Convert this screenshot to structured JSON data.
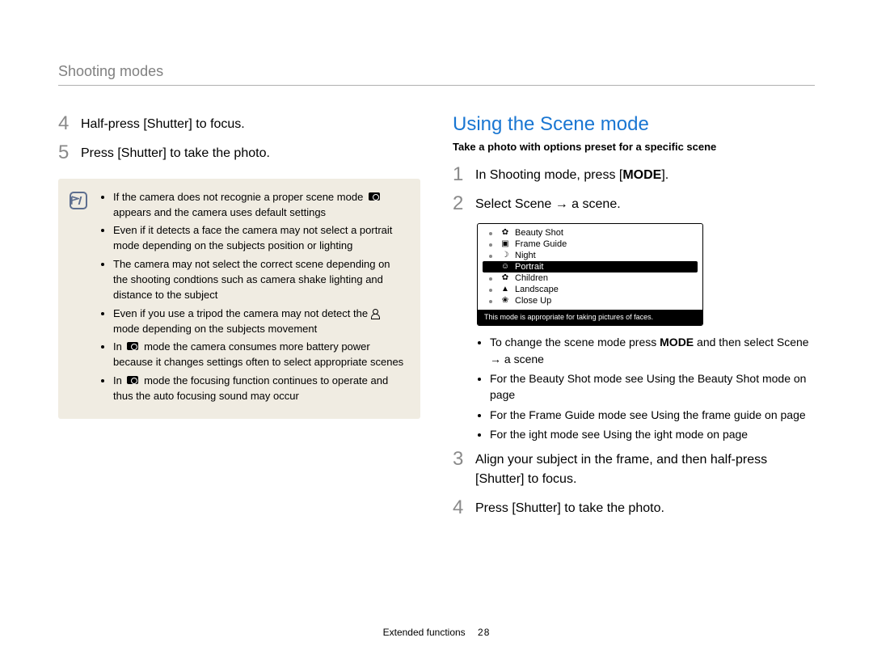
{
  "header": {
    "title": "Shooting modes"
  },
  "left": {
    "steps": [
      {
        "num": "4",
        "text": "Half-press [Shutter] to focus."
      },
      {
        "num": "5",
        "text": "Press [Shutter] to take the photo."
      }
    ],
    "note": [
      {
        "pre": "If the camera does not recognie a proper scene mode ",
        "icon": "cam",
        "post": " appears and the camera uses default settings"
      },
      {
        "pre": "Even if it detects a face the camera may not select a portrait mode depending on the subjects position or lighting",
        "icon": "",
        "post": ""
      },
      {
        "pre": "The camera may not select the correct scene depending on the shooting condtions such as camera shake lighting and distance to the subject",
        "icon": "",
        "post": ""
      },
      {
        "pre": "Even if you use a tripod the camera may not detect the ",
        "icon": "person",
        "post": " mode depending on the subjects movement"
      },
      {
        "pre": "In ",
        "icon": "cam",
        "post": " mode the camera consumes more battery power because it changes settings often to select appropriate scenes"
      },
      {
        "pre": "In ",
        "icon": "cam",
        "post": " mode the focusing function continues to operate and thus the auto focusing sound may occur"
      }
    ]
  },
  "right": {
    "section_title": "Using the Scene mode",
    "section_sub": "Take a photo with options preset for a specific scene",
    "step1_pre": "In Shooting mode, press [",
    "step1_bold": "MODE",
    "step1_post": "].",
    "step2": "Select Scene → a scene.",
    "scene_items": [
      {
        "icon": "✿",
        "label": "Beauty Shot"
      },
      {
        "icon": "▣",
        "label": "Frame Guide"
      },
      {
        "icon": "☽",
        "label": "Night"
      },
      {
        "icon": "☺",
        "label": "Portrait",
        "selected": true
      },
      {
        "icon": "✿",
        "label": "Children"
      },
      {
        "icon": "▲",
        "label": "Landscape"
      },
      {
        "icon": "❀",
        "label": "Close Up"
      }
    ],
    "scene_desc": "This mode is appropriate for taking pictures of faces.",
    "tips": [
      {
        "pre": "To change the scene mode press ",
        "bold": "MODE",
        "post": " and then select Scene → a scene"
      },
      {
        "pre": "For the Beauty Shot mode see Using the Beauty Shot mode on page",
        "bold": "",
        "post": ""
      },
      {
        "pre": "For the Frame Guide mode see Using the frame guide on page",
        "bold": "",
        "post": ""
      },
      {
        "pre": "For the ight mode see Using the ight mode on page",
        "bold": "",
        "post": ""
      }
    ],
    "step3": "Align your subject in the frame, and then half-press [Shutter] to focus.",
    "step4": "Press [Shutter] to take the photo."
  },
  "footer": {
    "label": "Extended functions",
    "page": "28"
  }
}
